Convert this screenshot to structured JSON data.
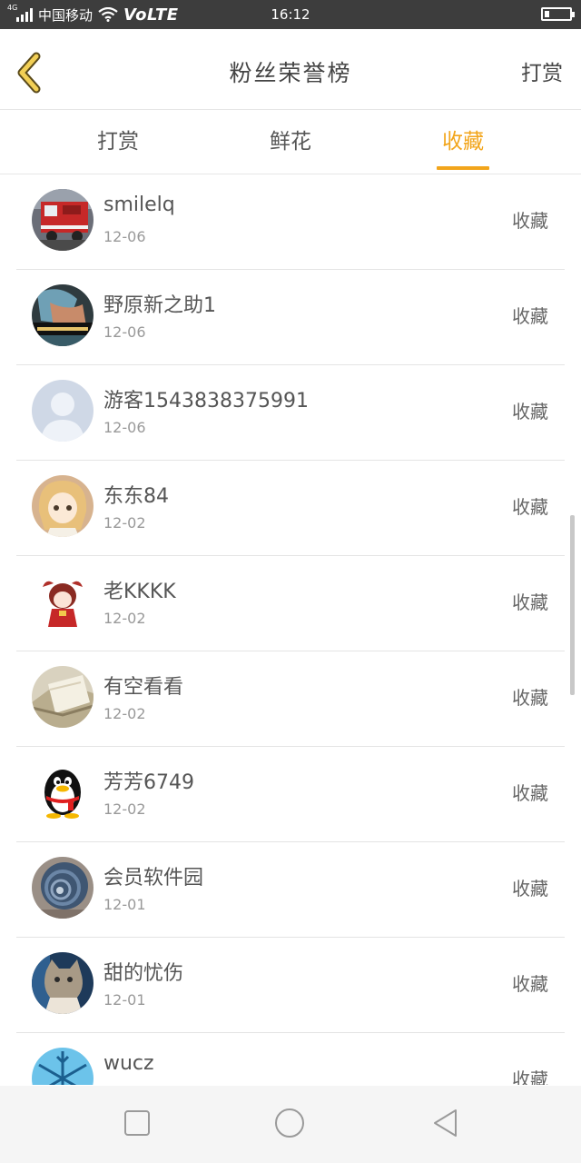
{
  "status_bar": {
    "network_tag": "4G",
    "carrier": "中国移动",
    "volte": "VoLTE",
    "time": "16:12"
  },
  "header": {
    "title": "粉丝荣誉榜",
    "action_label": "打赏",
    "accent_color": "#f2a51b"
  },
  "tabs": [
    {
      "label": "打赏",
      "active": false
    },
    {
      "label": "鲜花",
      "active": false
    },
    {
      "label": "收藏",
      "active": true
    }
  ],
  "list": [
    {
      "name": "smilelq",
      "date": "12-06",
      "action": "收藏",
      "avatar": "fire-truck-avatar"
    },
    {
      "name": "野原新之助1",
      "date": "12-06",
      "action": "收藏",
      "avatar": "photo-avatar"
    },
    {
      "name": "游客1543838375991",
      "date": "12-06",
      "action": "收藏",
      "avatar": "default-user-avatar"
    },
    {
      "name": "东东84",
      "date": "12-02",
      "action": "收藏",
      "avatar": "anime-girl-avatar"
    },
    {
      "name": "老KKKK",
      "date": "12-02",
      "action": "收藏",
      "avatar": "anime-chibi-avatar"
    },
    {
      "name": "有空看看",
      "date": "12-02",
      "action": "收藏",
      "avatar": "book-avatar"
    },
    {
      "name": "芳芳6749",
      "date": "12-02",
      "action": "收藏",
      "avatar": "penguin-avatar"
    },
    {
      "name": "会员软件园",
      "date": "12-01",
      "action": "收藏",
      "avatar": "snail-avatar"
    },
    {
      "name": "甜的忧伤",
      "date": "12-01",
      "action": "收藏",
      "avatar": "cat-avatar"
    },
    {
      "name": "wucz",
      "date": "",
      "action": "收藏",
      "avatar": "snowflake-avatar"
    }
  ]
}
